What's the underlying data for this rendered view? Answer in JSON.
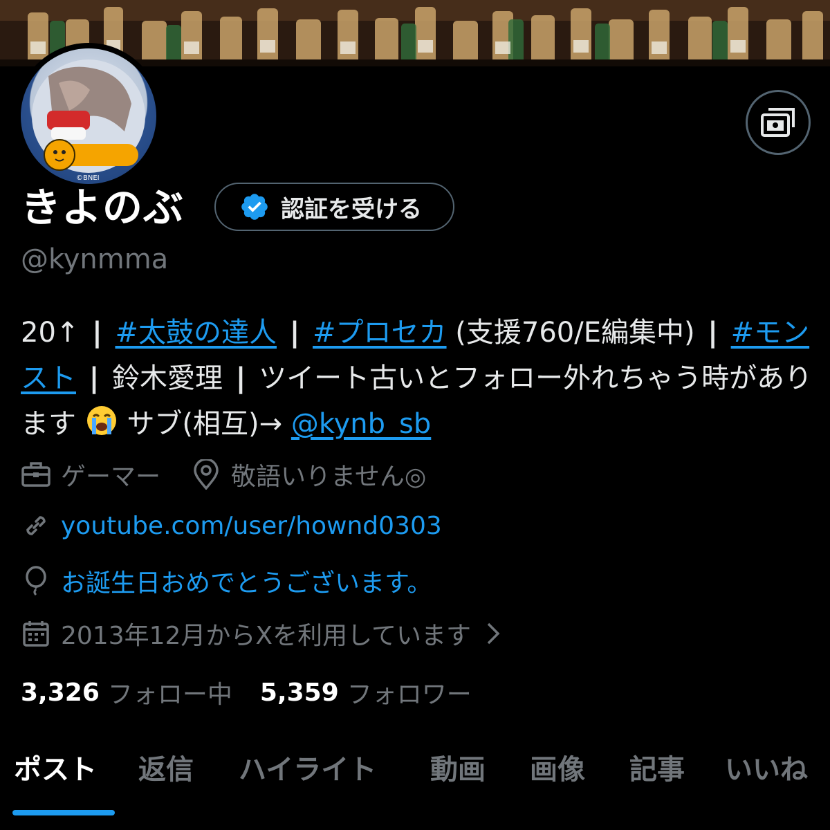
{
  "profile": {
    "display_name": "きよのぶ",
    "handle": "@kynmma",
    "verify_button_label": "認証を受ける",
    "avatar_credit": "©BNEI"
  },
  "bio": {
    "part1": "20↑",
    "sep": "|",
    "tag_taiko": "#太鼓の達人",
    "tag_proseka": "#プロセカ",
    "part2": "(支援760/E編集中)",
    "tag_monst": "#モンスト",
    "part3": "鈴木愛理",
    "part4": "ツイート古いとフォロー外れちゃう時があります",
    "emoji": "loudly-crying-face",
    "part5": "サブ(相互)→",
    "mention": "@kynb_sb"
  },
  "meta": {
    "category": "ゲーマー",
    "location": "敬語いりません◎",
    "website": "youtube.com/user/hownd0303",
    "birthday": "お誕生日おめでとうございます。",
    "joined": "2013年12月からXを利用しています"
  },
  "stats": {
    "following_count": "3,326",
    "following_label": "フォロー中",
    "followers_count": "5,359",
    "followers_label": "フォロワー"
  },
  "tabs": [
    {
      "label": "ポスト",
      "active": true
    },
    {
      "label": "返信",
      "active": false
    },
    {
      "label": "ハイライト",
      "active": false
    },
    {
      "label": "動画",
      "active": false
    },
    {
      "label": "画像",
      "active": false
    },
    {
      "label": "記事",
      "active": false
    },
    {
      "label": "いいね",
      "active": false
    }
  ],
  "icons": {
    "media": "media-viewer-icon",
    "verified": "verified-badge-icon",
    "category": "briefcase-icon",
    "location": "location-pin-icon",
    "website": "link-icon",
    "birthday": "balloon-icon",
    "joined": "calendar-icon",
    "chevron": "chevron-right-icon"
  },
  "colors": {
    "accent": "#1d9bf0",
    "background": "#000000",
    "text_primary": "#e7e9ea",
    "text_secondary": "#71767b",
    "border": "#536471"
  }
}
